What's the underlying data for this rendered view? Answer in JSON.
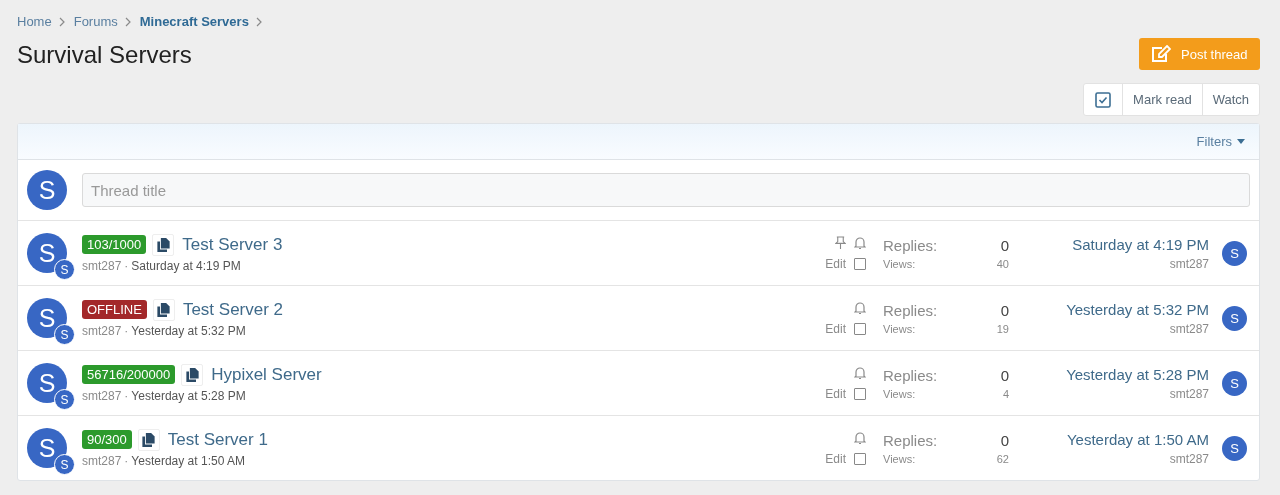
{
  "breadcrumbs": [
    {
      "label": "Home",
      "current": false
    },
    {
      "label": "Forums",
      "current": false
    },
    {
      "label": "Minecraft Servers",
      "current": true
    }
  ],
  "page_title": "Survival Servers",
  "post_button": "Post thread",
  "actions": [
    "Mark read",
    "Watch"
  ],
  "filters": "Filters",
  "new_thread": {
    "avatar_letter": "S",
    "placeholder": "Thread title"
  },
  "threads": [
    {
      "avatar_letter": "S",
      "sub_avatar_letter": "S",
      "prefix": "103/1000",
      "color": "#2c9a2c",
      "title": "Test Server 3",
      "author": "smt287",
      "separator": "·",
      "date": "Saturday at 4:19 PM",
      "pinned": true,
      "watched": true,
      "edit": "Edit",
      "checked": false,
      "replies_label": "Replies:",
      "replies": "0",
      "views_label": "Views:",
      "views": "40",
      "last_date": "Saturday at 4:19 PM",
      "last_user": "smt287",
      "last_avatar_letter": "S"
    },
    {
      "avatar_letter": "S",
      "sub_avatar_letter": "S",
      "prefix": "OFFLINE",
      "color": "#a3282a",
      "title": "Test Server 2",
      "author": "smt287",
      "separator": "·",
      "date": "Yesterday at 5:32 PM",
      "pinned": false,
      "watched": true,
      "edit": "Edit",
      "checked": false,
      "replies_label": "Replies:",
      "replies": "0",
      "views_label": "Views:",
      "views": "19",
      "last_date": "Yesterday at 5:32 PM",
      "last_user": "smt287",
      "last_avatar_letter": "S"
    },
    {
      "avatar_letter": "S",
      "sub_avatar_letter": "S",
      "prefix": "56716/200000",
      "color": "#2c9a2c",
      "title": "Hypixel Server",
      "author": "smt287",
      "separator": "·",
      "date": "Yesterday at 5:28 PM",
      "pinned": false,
      "watched": true,
      "edit": "Edit",
      "checked": false,
      "replies_label": "Replies:",
      "replies": "0",
      "views_label": "Views:",
      "views": "4",
      "last_date": "Yesterday at 5:28 PM",
      "last_user": "smt287",
      "last_avatar_letter": "S"
    },
    {
      "avatar_letter": "S",
      "sub_avatar_letter": "S",
      "prefix": "90/300",
      "color": "#2c9a2c",
      "title": "Test Server 1",
      "author": "smt287",
      "separator": "·",
      "date": "Yesterday at 1:50 AM",
      "pinned": false,
      "watched": true,
      "edit": "Edit",
      "checked": false,
      "replies_label": "Replies:",
      "replies": "0",
      "views_label": "Views:",
      "views": "62",
      "last_date": "Yesterday at 1:50 AM",
      "last_user": "smt287",
      "last_avatar_letter": "S"
    }
  ]
}
